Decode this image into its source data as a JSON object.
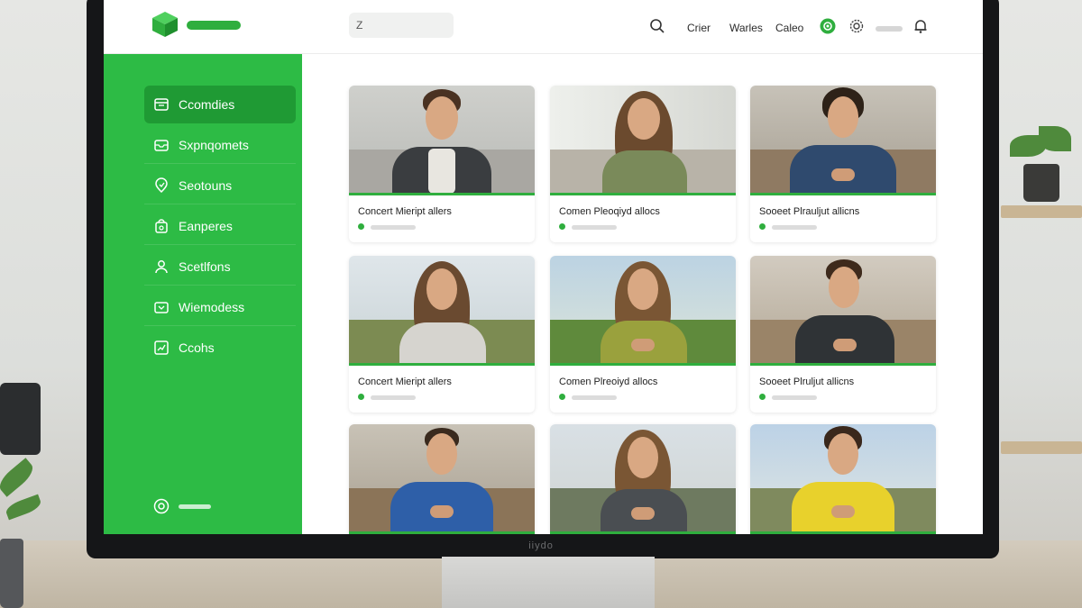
{
  "monitor": {
    "brand": "iiydo"
  },
  "header": {
    "search_value": "Z",
    "nav": [
      "Crier",
      "Warles",
      "Caleo"
    ]
  },
  "sidebar": {
    "items": [
      {
        "label": "Ccomdies",
        "icon": "calendar-icon",
        "active": true
      },
      {
        "label": "Sxpnqomets",
        "icon": "inbox-icon",
        "active": false
      },
      {
        "label": "Seotouns",
        "icon": "location-icon",
        "active": false
      },
      {
        "label": "Eanperes",
        "icon": "bag-icon",
        "active": false
      },
      {
        "label": "Scetlfons",
        "icon": "user-icon",
        "active": false
      },
      {
        "label": "Wiemodess",
        "icon": "tray-icon",
        "active": false
      },
      {
        "label": "Ccohs",
        "icon": "chart-icon",
        "active": false
      }
    ]
  },
  "cards": [
    {
      "title": "Concert Mieript allers",
      "scene": "office"
    },
    {
      "title": "Comen Pleoqiyd allocs",
      "scene": "office"
    },
    {
      "title": "Sooeet Plrauljut allicns",
      "scene": "office"
    },
    {
      "title": "Concert Mieript allers",
      "scene": "outdoor"
    },
    {
      "title": "Comen Plreoiyd allocs",
      "scene": "outdoor"
    },
    {
      "title": "Sooeet Plruljut allicns",
      "scene": "office"
    },
    {
      "title": "",
      "scene": "office"
    },
    {
      "title": "",
      "scene": "outdoor"
    },
    {
      "title": "",
      "scene": "outdoor"
    }
  ],
  "colors": {
    "brand_green": "#2dbb45",
    "active_green": "#1f9a34"
  }
}
